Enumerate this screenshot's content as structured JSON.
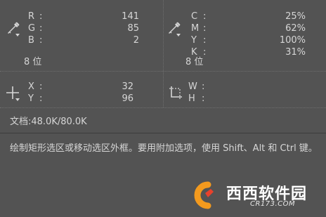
{
  "rgb": {
    "labels": [
      "R",
      "G",
      "B"
    ],
    "values": [
      "141",
      "85",
      "2"
    ],
    "bits": "8 位"
  },
  "cmyk": {
    "labels": [
      "C",
      "M",
      "Y",
      "K"
    ],
    "values": [
      "25%",
      "62%",
      "100%",
      "31%"
    ],
    "bits": "8 位"
  },
  "xy": {
    "labels": [
      "X",
      "Y"
    ],
    "values": [
      "32",
      "96"
    ]
  },
  "wh": {
    "labels": [
      "W",
      "H"
    ],
    "values": [
      "",
      ""
    ]
  },
  "document": "文档:48.0K/80.0K",
  "hint": "绘制矩形选区或移动选区外框。要用附加选项，使用 Shift、Alt 和 Ctrl 键。",
  "watermark": {
    "logo_text": "西西软件园",
    "url": "CR173.COM"
  },
  "icons": {
    "rgb_sampler": "eyedropper-icon",
    "cmyk_sampler": "eyedropper-icon",
    "position": "crosshair-icon",
    "size": "selection-size-icon"
  },
  "colors": {
    "background": "#535353",
    "text": "#d6d6d6",
    "watermark_orange": "#f39a1e",
    "watermark_red": "#e8412c"
  }
}
